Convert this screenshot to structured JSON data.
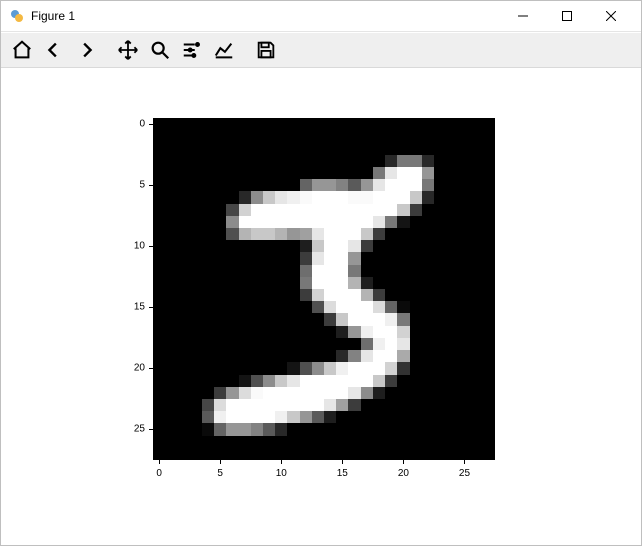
{
  "window": {
    "title": "Figure 1",
    "min": "Minimize",
    "max": "Maximize",
    "close": "Close"
  },
  "toolbar": {
    "home": "Home",
    "back": "Back",
    "forward": "Forward",
    "pan": "Pan",
    "zoom": "Zoom",
    "subplots": "Configure subplots",
    "axes": "Edit axis",
    "save": "Save"
  },
  "chart_data": {
    "type": "heatmap",
    "title": "",
    "xlabel": "",
    "ylabel": "",
    "x_ticks": [
      0,
      5,
      10,
      15,
      20,
      25
    ],
    "y_ticks": [
      0,
      5,
      10,
      15,
      20,
      25
    ],
    "xlim": [
      -0.5,
      27.5
    ],
    "ylim": [
      27.5,
      -0.5
    ],
    "cmap": "gray",
    "shape": [
      28,
      28
    ],
    "values": [
      [
        0,
        0,
        0,
        0,
        0,
        0,
        0,
        0,
        0,
        0,
        0,
        0,
        0,
        0,
        0,
        0,
        0,
        0,
        0,
        0,
        0,
        0,
        0,
        0,
        0,
        0,
        0,
        0
      ],
      [
        0,
        0,
        0,
        0,
        0,
        0,
        0,
        0,
        0,
        0,
        0,
        0,
        0,
        0,
        0,
        0,
        0,
        0,
        0,
        0,
        0,
        0,
        0,
        0,
        0,
        0,
        0,
        0
      ],
      [
        0,
        0,
        0,
        0,
        0,
        0,
        0,
        0,
        0,
        0,
        0,
        0,
        0,
        0,
        0,
        0,
        0,
        0,
        0,
        0,
        0,
        0,
        0,
        0,
        0,
        0,
        0,
        0
      ],
      [
        0,
        0,
        0,
        0,
        0,
        0,
        0,
        0,
        0,
        0,
        0,
        0,
        0,
        0,
        0,
        0,
        0,
        0,
        0,
        40,
        120,
        120,
        40,
        0,
        0,
        0,
        0,
        0
      ],
      [
        0,
        0,
        0,
        0,
        0,
        0,
        0,
        0,
        0,
        0,
        0,
        0,
        0,
        0,
        0,
        0,
        0,
        0,
        120,
        230,
        255,
        255,
        150,
        0,
        0,
        0,
        0,
        0
      ],
      [
        0,
        0,
        0,
        0,
        0,
        0,
        0,
        0,
        0,
        0,
        0,
        0,
        100,
        150,
        150,
        130,
        90,
        150,
        230,
        255,
        255,
        255,
        120,
        0,
        0,
        0,
        0,
        0
      ],
      [
        0,
        0,
        0,
        0,
        0,
        0,
        0,
        40,
        140,
        200,
        230,
        240,
        250,
        255,
        255,
        255,
        250,
        250,
        255,
        255,
        255,
        200,
        40,
        0,
        0,
        0,
        0,
        0
      ],
      [
        0,
        0,
        0,
        0,
        0,
        0,
        70,
        210,
        255,
        255,
        255,
        255,
        255,
        255,
        255,
        255,
        255,
        255,
        255,
        255,
        200,
        60,
        0,
        0,
        0,
        0,
        0,
        0
      ],
      [
        0,
        0,
        0,
        0,
        0,
        0,
        140,
        255,
        255,
        255,
        255,
        255,
        255,
        255,
        255,
        255,
        255,
        255,
        230,
        120,
        20,
        0,
        0,
        0,
        0,
        0,
        0,
        0
      ],
      [
        0,
        0,
        0,
        0,
        0,
        0,
        80,
        180,
        200,
        200,
        180,
        150,
        160,
        230,
        255,
        255,
        255,
        200,
        60,
        0,
        0,
        0,
        0,
        0,
        0,
        0,
        0,
        0
      ],
      [
        0,
        0,
        0,
        0,
        0,
        0,
        0,
        0,
        0,
        0,
        0,
        0,
        30,
        200,
        255,
        255,
        230,
        60,
        0,
        0,
        0,
        0,
        0,
        0,
        0,
        0,
        0,
        0
      ],
      [
        0,
        0,
        0,
        0,
        0,
        0,
        0,
        0,
        0,
        0,
        0,
        0,
        60,
        230,
        255,
        255,
        150,
        0,
        0,
        0,
        0,
        0,
        0,
        0,
        0,
        0,
        0,
        0
      ],
      [
        0,
        0,
        0,
        0,
        0,
        0,
        0,
        0,
        0,
        0,
        0,
        0,
        110,
        255,
        255,
        255,
        120,
        0,
        0,
        0,
        0,
        0,
        0,
        0,
        0,
        0,
        0,
        0
      ],
      [
        0,
        0,
        0,
        0,
        0,
        0,
        0,
        0,
        0,
        0,
        0,
        0,
        120,
        255,
        255,
        255,
        180,
        30,
        0,
        0,
        0,
        0,
        0,
        0,
        0,
        0,
        0,
        0
      ],
      [
        0,
        0,
        0,
        0,
        0,
        0,
        0,
        0,
        0,
        0,
        0,
        0,
        60,
        210,
        255,
        255,
        255,
        180,
        60,
        0,
        0,
        0,
        0,
        0,
        0,
        0,
        0,
        0
      ],
      [
        0,
        0,
        0,
        0,
        0,
        0,
        0,
        0,
        0,
        0,
        0,
        0,
        0,
        80,
        220,
        255,
        255,
        255,
        220,
        100,
        10,
        0,
        0,
        0,
        0,
        0,
        0,
        0
      ],
      [
        0,
        0,
        0,
        0,
        0,
        0,
        0,
        0,
        0,
        0,
        0,
        0,
        0,
        0,
        60,
        200,
        255,
        255,
        255,
        240,
        120,
        0,
        0,
        0,
        0,
        0,
        0,
        0
      ],
      [
        0,
        0,
        0,
        0,
        0,
        0,
        0,
        0,
        0,
        0,
        0,
        0,
        0,
        0,
        0,
        30,
        150,
        240,
        255,
        255,
        210,
        0,
        0,
        0,
        0,
        0,
        0,
        0
      ],
      [
        0,
        0,
        0,
        0,
        0,
        0,
        0,
        0,
        0,
        0,
        0,
        0,
        0,
        0,
        0,
        0,
        0,
        110,
        240,
        255,
        230,
        0,
        0,
        0,
        0,
        0,
        0,
        0
      ],
      [
        0,
        0,
        0,
        0,
        0,
        0,
        0,
        0,
        0,
        0,
        0,
        0,
        0,
        0,
        0,
        40,
        130,
        230,
        255,
        255,
        170,
        0,
        0,
        0,
        0,
        0,
        0,
        0
      ],
      [
        0,
        0,
        0,
        0,
        0,
        0,
        0,
        0,
        0,
        0,
        0,
        20,
        80,
        140,
        200,
        240,
        255,
        255,
        255,
        210,
        50,
        0,
        0,
        0,
        0,
        0,
        0,
        0
      ],
      [
        0,
        0,
        0,
        0,
        0,
        0,
        0,
        20,
        80,
        140,
        200,
        230,
        255,
        255,
        255,
        255,
        255,
        255,
        200,
        60,
        0,
        0,
        0,
        0,
        0,
        0,
        0,
        0
      ],
      [
        0,
        0,
        0,
        0,
        0,
        60,
        150,
        220,
        250,
        255,
        255,
        255,
        255,
        255,
        255,
        255,
        230,
        140,
        30,
        0,
        0,
        0,
        0,
        0,
        0,
        0,
        0,
        0
      ],
      [
        0,
        0,
        0,
        0,
        70,
        220,
        255,
        255,
        255,
        255,
        255,
        255,
        255,
        255,
        230,
        160,
        60,
        0,
        0,
        0,
        0,
        0,
        0,
        0,
        0,
        0,
        0,
        0
      ],
      [
        0,
        0,
        0,
        0,
        90,
        240,
        255,
        255,
        255,
        255,
        240,
        200,
        150,
        90,
        30,
        0,
        0,
        0,
        0,
        0,
        0,
        0,
        0,
        0,
        0,
        0,
        0,
        0
      ],
      [
        0,
        0,
        0,
        0,
        10,
        100,
        150,
        150,
        130,
        90,
        40,
        0,
        0,
        0,
        0,
        0,
        0,
        0,
        0,
        0,
        0,
        0,
        0,
        0,
        0,
        0,
        0,
        0
      ],
      [
        0,
        0,
        0,
        0,
        0,
        0,
        0,
        0,
        0,
        0,
        0,
        0,
        0,
        0,
        0,
        0,
        0,
        0,
        0,
        0,
        0,
        0,
        0,
        0,
        0,
        0,
        0,
        0
      ],
      [
        0,
        0,
        0,
        0,
        0,
        0,
        0,
        0,
        0,
        0,
        0,
        0,
        0,
        0,
        0,
        0,
        0,
        0,
        0,
        0,
        0,
        0,
        0,
        0,
        0,
        0,
        0,
        0
      ]
    ]
  }
}
